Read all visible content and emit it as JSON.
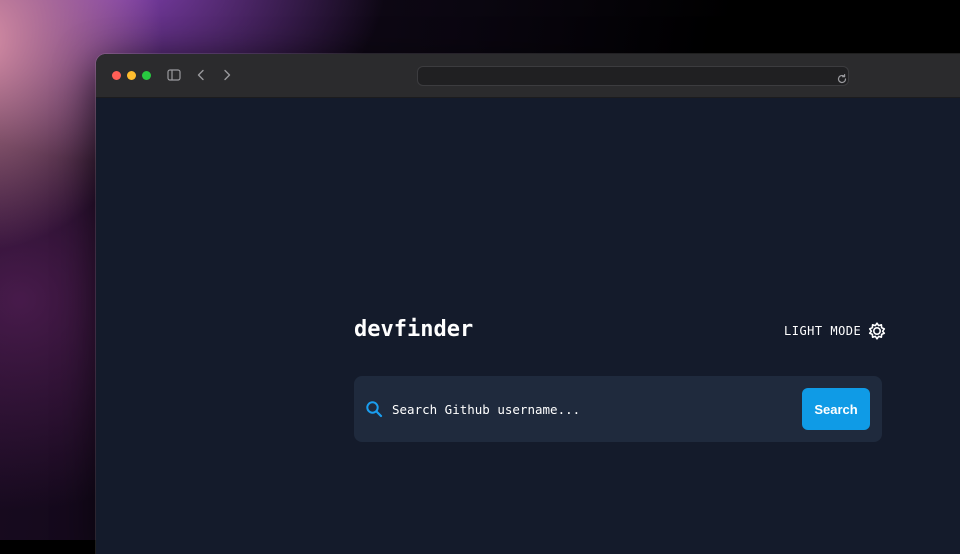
{
  "app": {
    "title": "devfinder",
    "theme_toggle_label": "LIGHT MODE"
  },
  "search": {
    "placeholder": "Search Github username...",
    "value": "",
    "button_label": "Search"
  },
  "browser": {
    "address": ""
  },
  "icons": {
    "window_controls": [
      "close-icon",
      "minimize-icon",
      "zoom-icon"
    ],
    "toolbar": [
      "sidebar-toggle-icon",
      "back-icon",
      "forward-icon",
      "reload-icon"
    ],
    "theme": "sun-icon",
    "search": "search-icon"
  },
  "colors": {
    "page_background": "#141b2b",
    "card_background": "#1f2a3d",
    "accent": "#0f9be6",
    "text": "#ffffff"
  }
}
